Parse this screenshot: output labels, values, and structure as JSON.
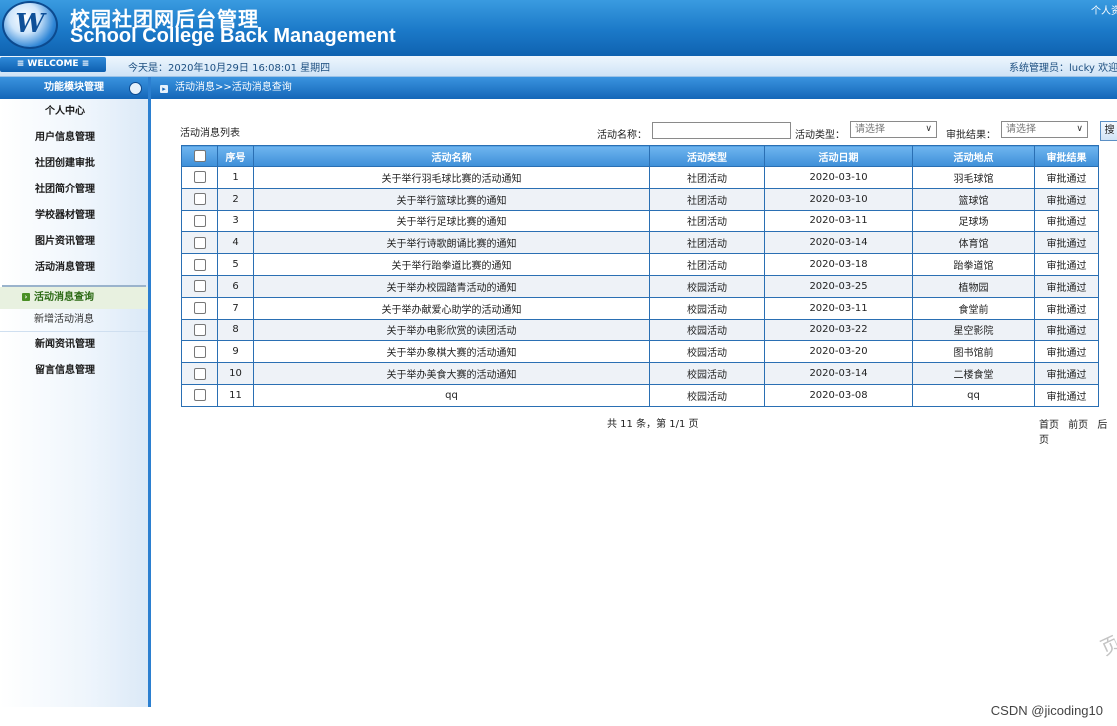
{
  "header": {
    "logo_letter": "W",
    "title_cn": "校园社团网后台管理",
    "title_en": "School College Back Management",
    "personal_link": "个人资料"
  },
  "infobar": {
    "welcome": "≡ WELCOME ≡",
    "today": "今天是：2020年10月29日  16:08:01  星期四",
    "admin": "系统管理员：lucky  欢迎您"
  },
  "sidebar": {
    "head": "功能模块管理",
    "items": [
      {
        "label": "个人中心"
      },
      {
        "label": "用户信息管理"
      },
      {
        "label": "社团创建审批"
      },
      {
        "label": "社团简介管理"
      },
      {
        "label": "学校器材管理"
      },
      {
        "label": "图片资讯管理"
      },
      {
        "label": "活动消息管理"
      }
    ],
    "sub_items": [
      {
        "label": "活动消息查询",
        "active": true
      },
      {
        "label": "新增活动消息",
        "active": false
      }
    ],
    "items_after": [
      {
        "label": "新闻资讯管理"
      },
      {
        "label": "留言信息管理"
      }
    ]
  },
  "breadcrumb": "活动消息>>活动消息查询",
  "list_title": "活动消息列表",
  "filters": {
    "name_label": "活动名称：",
    "name_value": "",
    "type_label": "活动类型：",
    "type_value": "请选择",
    "result_label": "审批结果：",
    "result_value": "请选择",
    "search_button": "搜索"
  },
  "table": {
    "headers": [
      "序号",
      "活动名称",
      "活动类型",
      "活动日期",
      "活动地点",
      "审批结果"
    ],
    "rows": [
      [
        "1",
        "关于举行羽毛球比赛的活动通知",
        "社团活动",
        "2020-03-10",
        "羽毛球馆",
        "审批通过"
      ],
      [
        "2",
        "关于举行篮球比赛的通知",
        "社团活动",
        "2020-03-10",
        "篮球馆",
        "审批通过"
      ],
      [
        "3",
        "关于举行足球比赛的通知",
        "社团活动",
        "2020-03-11",
        "足球场",
        "审批通过"
      ],
      [
        "4",
        "关于举行诗歌朗诵比赛的通知",
        "社团活动",
        "2020-03-14",
        "体育馆",
        "审批通过"
      ],
      [
        "5",
        "关于举行跆拳道比赛的通知",
        "社团活动",
        "2020-03-18",
        "跆拳道馆",
        "审批通过"
      ],
      [
        "6",
        "关于举办校园踏青活动的通知",
        "校园活动",
        "2020-03-25",
        "植物园",
        "审批通过"
      ],
      [
        "7",
        "关于举办献爱心助学的活动通知",
        "校园活动",
        "2020-03-11",
        "食堂前",
        "审批通过"
      ],
      [
        "8",
        "关于举办电影欣赏的读团活动",
        "校园活动",
        "2020-03-22",
        "星空影院",
        "审批通过"
      ],
      [
        "9",
        "关于举办象棋大赛的活动通知",
        "校园活动",
        "2020-03-20",
        "图书馆前",
        "审批通过"
      ],
      [
        "10",
        "关于举办美食大赛的活动通知",
        "校园活动",
        "2020-03-14",
        "二楼食堂",
        "审批通过"
      ],
      [
        "11",
        "qq",
        "校园活动",
        "2020-03-08",
        "qq",
        "审批通过"
      ]
    ]
  },
  "pager": {
    "summary": "共 11 条，第 1/1 页",
    "first": "首页",
    "prev": "前页",
    "next": "后页"
  },
  "watermark": "CSDN @jicoding10",
  "stamp": "页"
}
